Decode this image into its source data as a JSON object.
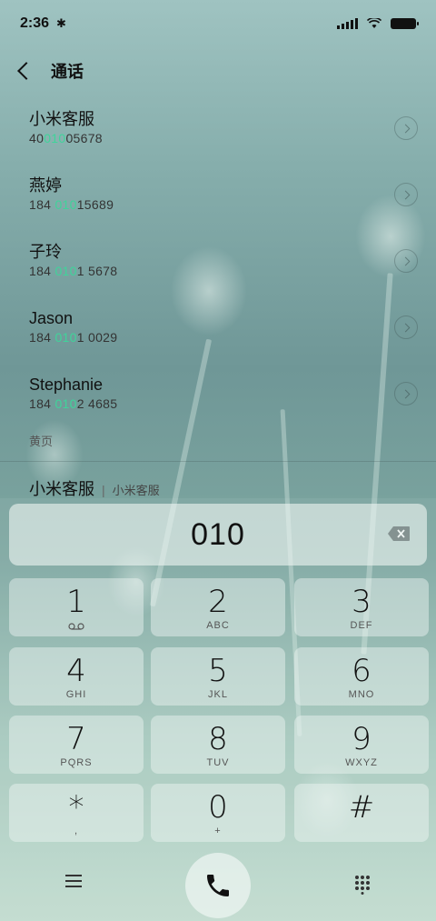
{
  "status": {
    "time": "2:36"
  },
  "header": {
    "title": "通话"
  },
  "contacts": [
    {
      "name": "小米客服",
      "pre": "40",
      "match": "010",
      "post": "05678"
    },
    {
      "name": "燕婷",
      "pre": "184 ",
      "match": "010",
      "post": "15689"
    },
    {
      "name": "子玲",
      "pre": "184 ",
      "match": "010",
      "post": "1 5678"
    },
    {
      "name": "Jason",
      "pre": "184 ",
      "match": "010",
      "post": "1 0029"
    },
    {
      "name": "Stephanie",
      "pre": "184 ",
      "match": "010",
      "post": "2 4685"
    }
  ],
  "yellow_pages": {
    "section_label": "黄页",
    "entry_name": "小米客服",
    "separator": "|",
    "entry_sub": "小米客服"
  },
  "dialer": {
    "input_value": "010",
    "keys": [
      {
        "digit": "1",
        "sub": ""
      },
      {
        "digit": "2",
        "sub": "ABC"
      },
      {
        "digit": "3",
        "sub": "DEF"
      },
      {
        "digit": "4",
        "sub": "GHI"
      },
      {
        "digit": "5",
        "sub": "JKL"
      },
      {
        "digit": "6",
        "sub": "MNO"
      },
      {
        "digit": "7",
        "sub": "PQRS"
      },
      {
        "digit": "8",
        "sub": "TUV"
      },
      {
        "digit": "9",
        "sub": "WXYZ"
      },
      {
        "digit": "*",
        "sub": ","
      },
      {
        "digit": "0",
        "sub": "+"
      },
      {
        "digit": "#",
        "sub": ""
      }
    ]
  },
  "colors": {
    "match_highlight": "#3fd49a"
  }
}
